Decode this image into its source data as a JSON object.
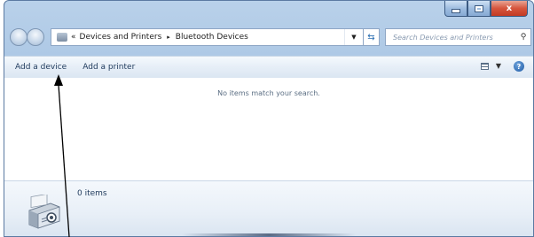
{
  "window": {
    "caption_buttons": {
      "minimize_icon": "minimize-icon",
      "maximize_icon": "maximize-icon",
      "close_label": "x"
    }
  },
  "navigation": {
    "back_icon": "back-arrow-icon",
    "forward_icon": "forward-arrow-icon",
    "breadcrumb": {
      "overflow": "«",
      "items": [
        "Devices and Printers",
        "Bluetooth Devices"
      ],
      "separator": "▸"
    },
    "dropdown_icon": "chevron-down-icon",
    "refresh_icon": "refresh-icon",
    "search_placeholder": "Search Devices and Printers"
  },
  "command_bar": {
    "add_device_label": "Add a device",
    "add_printer_label": "Add a printer",
    "view_icon": "view-options-icon",
    "help_label": "?"
  },
  "content": {
    "empty_message": "No items match your search."
  },
  "details_pane": {
    "count_text": "0 items",
    "thumbnail_icon": "devices-printers-icon"
  },
  "colors": {
    "frame": "#a6c3e2",
    "close_button": "#d6553d",
    "command_bar": "#e6eef7",
    "text": "#1e395b"
  }
}
